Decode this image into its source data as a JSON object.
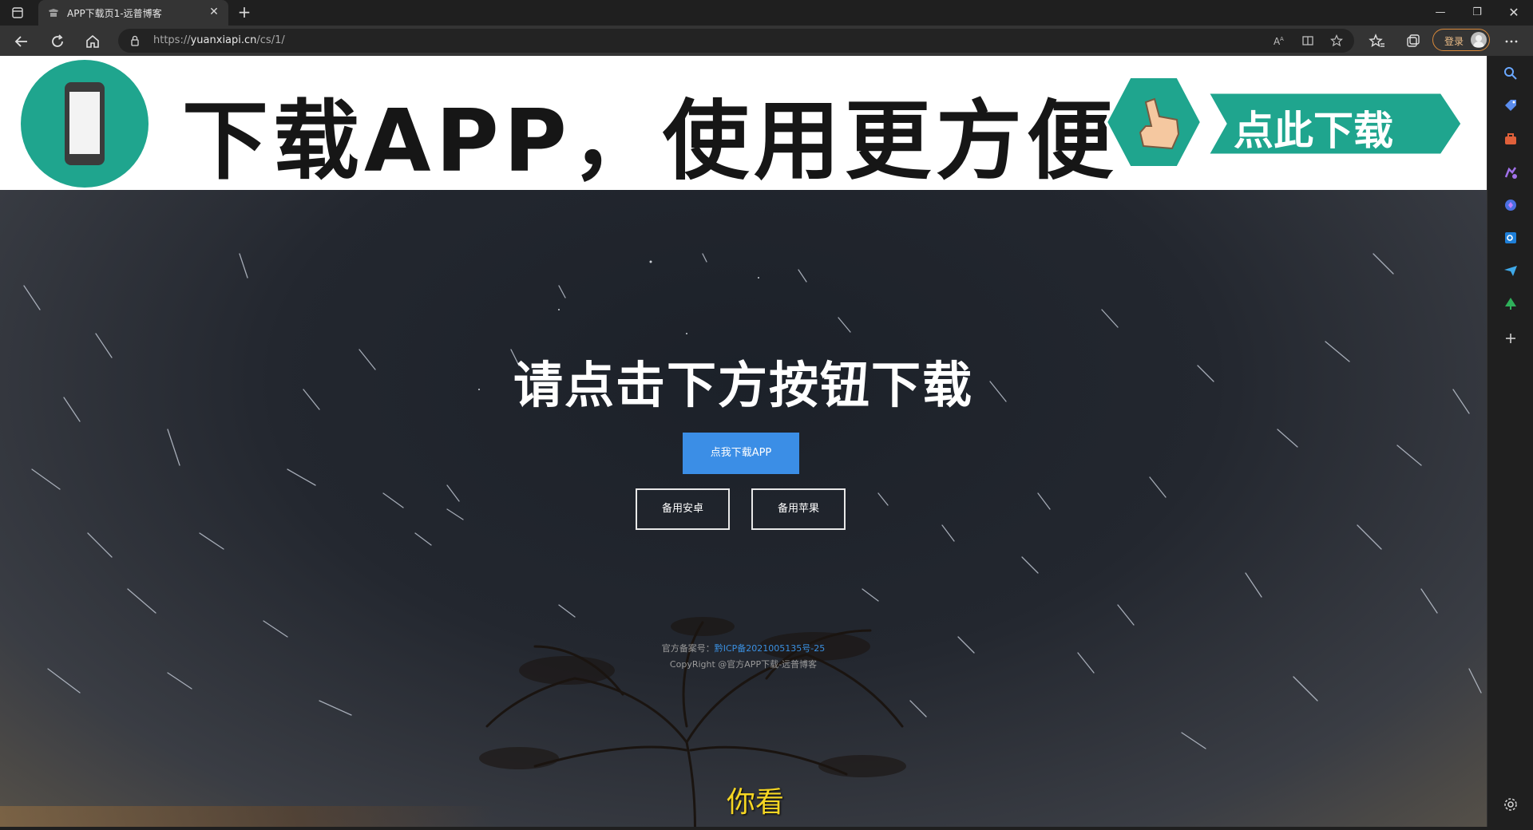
{
  "browser": {
    "tab_title": "APP下载页1-远普博客",
    "url_scheme": "https://",
    "url_host": "yuanxiapi.cn",
    "url_path": "/cs/1/",
    "login_label": "登录"
  },
  "banner": {
    "headline": "下载APP，使用更方便",
    "download_label": "点此下载"
  },
  "main": {
    "title": "请点击下方按钮下载",
    "primary_button": "点我下载APP",
    "android_button": "备用安卓",
    "ios_button": "备用苹果"
  },
  "footer": {
    "icp_prefix": "官方备案号：",
    "icp_number": "黔ICP备2021005135号-25",
    "copyright": "CopyRight @官方APP下载-远普博客"
  },
  "video_subtitle": "你看",
  "colors": {
    "primary_button": "#3b8ee6",
    "banner_teal": "#1fa58e",
    "icp_link": "#3a8fe0",
    "subtitle": "#f5d623"
  }
}
